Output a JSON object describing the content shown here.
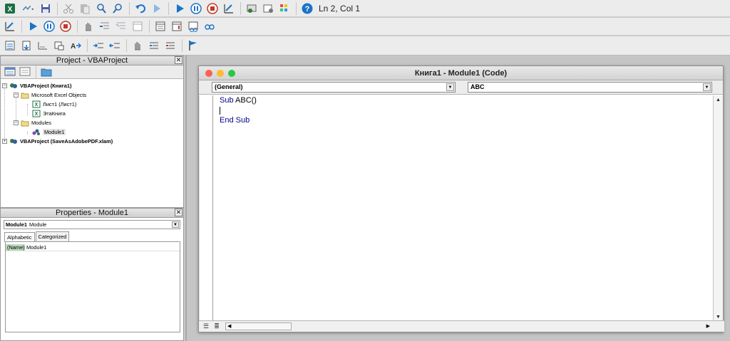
{
  "toolbar": {
    "status": "Ln 2, Col 1"
  },
  "project": {
    "title": "Project - VBAProject",
    "close": "✕",
    "tree": [
      {
        "label": "VBAProject (Книга1)",
        "bold": true
      },
      {
        "label": "Microsoft Excel Objects",
        "bold": false
      },
      {
        "label": "Лист1 (Лист1)",
        "bold": false
      },
      {
        "label": "ЭтаКнига",
        "bold": false
      },
      {
        "label": "Modules",
        "bold": false
      },
      {
        "label": "Module1",
        "bold": false
      },
      {
        "label": "VBAProject (SaveAsAdobePDF.xlam)",
        "bold": true
      }
    ]
  },
  "properties": {
    "title": "Properties - Module1",
    "close": "✕",
    "object_name": "Module1",
    "object_type": "Module",
    "tabs": [
      "Alphabetic",
      "Categorized"
    ],
    "rows": [
      {
        "name": "(Name)",
        "value": "Module1"
      }
    ]
  },
  "code_window": {
    "title": "Книга1 - Module1 (Code)",
    "object_combo": "(General)",
    "procedure_combo": "ABC",
    "lines": {
      "l1_kw": "Sub",
      "l1_rest": " ABC()",
      "l3_kw": "End Sub"
    }
  },
  "colors": {
    "close_light": "#ff5f57",
    "minimize_light": "#febc2e",
    "zoom_light": "#28c840",
    "keyword": "#00008b",
    "accent_blue": "#1a73c9"
  }
}
